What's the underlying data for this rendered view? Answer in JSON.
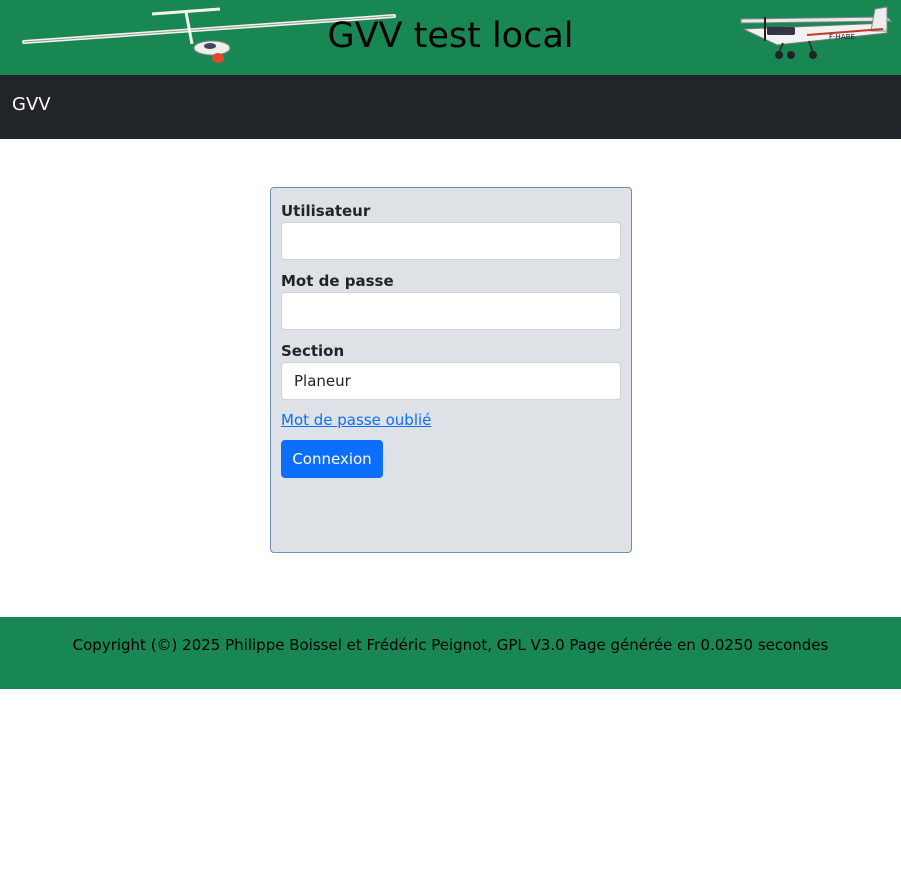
{
  "banner": {
    "title": "GVV test local",
    "aircraft_registration": "F-HABE",
    "left_image": "glider-image",
    "right_image": "airplane-image"
  },
  "navbar": {
    "brand": "GVV"
  },
  "login": {
    "user_label": "Utilisateur",
    "user_value": "",
    "password_label": "Mot de passe",
    "password_value": "",
    "section_label": "Section",
    "section_value": "Planeur",
    "forgot_link": "Mot de passe oublié",
    "submit_label": "Connexion"
  },
  "footer": {
    "text": "Copyright (©) 2025 Philippe Boissel et Frédéric Peignot, GPL V3.0 Page générée en 0.0250 secondes"
  },
  "colors": {
    "banner_green": "#198754",
    "navbar_dark": "#212529",
    "card_gray": "#dee2e6",
    "primary_blue": "#0d6efd"
  }
}
